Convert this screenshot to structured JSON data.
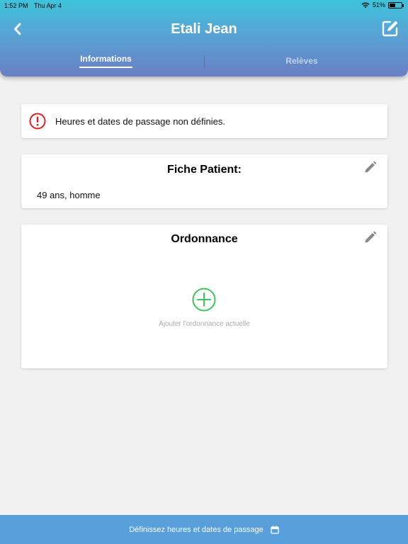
{
  "status_bar": {
    "time": "1:52 PM",
    "date": "Thu Apr 4",
    "battery": "51%",
    "battery_level": 0.51
  },
  "header": {
    "title": "Etali Jean",
    "back_icon": "chevron-left-icon",
    "edit_icon": "edit-square-icon",
    "gradient_top": "#3dc3d9",
    "gradient_bottom": "#6a7fc4"
  },
  "tabs": [
    {
      "label": "Informations",
      "active": true
    },
    {
      "label": "Relèves",
      "active": false
    }
  ],
  "alert": {
    "icon": "exclamation-circle-icon",
    "text": "Heures et dates de passage non définies.",
    "color": "#e02020"
  },
  "patient_card": {
    "title": "Fiche Patient:",
    "info": "49 ans, homme",
    "edit_icon": "pencil-icon"
  },
  "ordonnance_card": {
    "title": "Ordonnance",
    "edit_icon": "pencil-icon",
    "add_icon": "plus-circle-icon",
    "add_label": "Ajouter l'ordonnance actuelle",
    "add_color": "#3cc45a"
  },
  "bottom_bar": {
    "label": "Définissez heures et dates de passage",
    "icon": "calendar-icon",
    "color": "#58a0dc"
  }
}
